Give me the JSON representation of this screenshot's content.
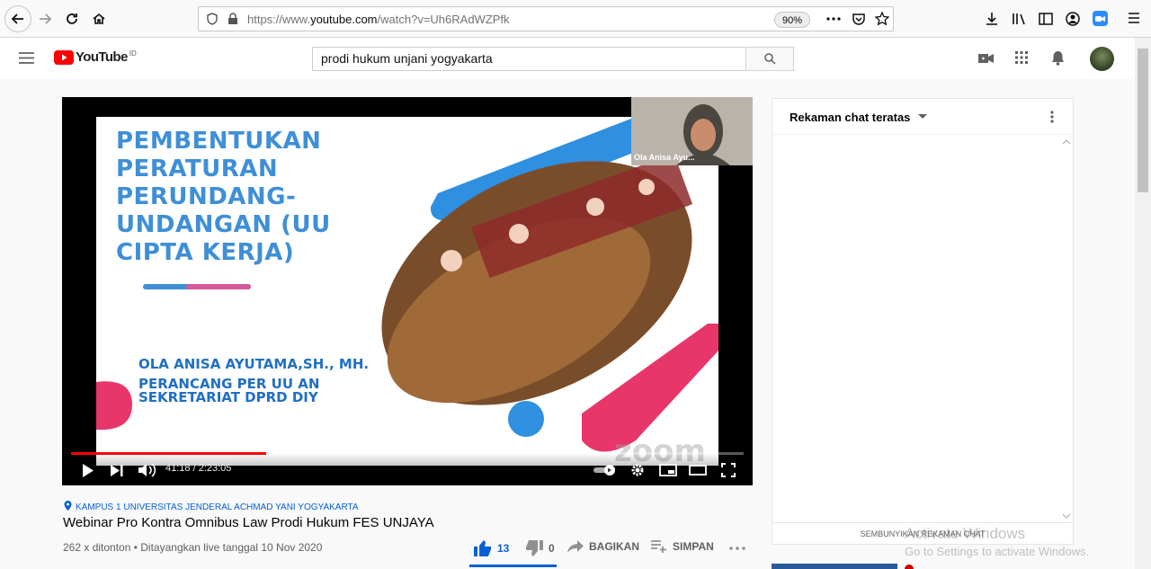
{
  "browser": {
    "url_prefix": "https://www.",
    "url_domain": "youtube.com",
    "url_path": "/watch?v=Uh6RAdWZPfk",
    "zoom": "90%"
  },
  "header": {
    "logo_text": "YouTube",
    "logo_region": "ID",
    "search_value": "prodi hukum unjani yogyakarta"
  },
  "player": {
    "slide_title": "PEMBENTUKAN PERATURAN PERUNDANG-UNDANGAN (UU CIPTA KERJA)",
    "speaker_name": "OLA ANISA AYUTAMA,SH., MH.",
    "speaker_role": "PERANCANG PER UU AN SEKRETARIAT DPRD DIY",
    "pip_name": "Ola Anisa Ayu...",
    "zoom_watermark": "zoom",
    "time": "41:18 / 2:23:05",
    "progress": 0.29
  },
  "video": {
    "location": "KAMPUS 1 UNIVERSITAS JENDERAL ACHMAD YANI YOGYAKARTA",
    "title": "Webinar Pro Kontra Omnibus Law Prodi Hukum FES UNJAYA",
    "info": "262 x ditonton • Ditayangkan live tanggal 10 Nov 2020",
    "likes": "13",
    "dislikes": "0",
    "share_label": "BAGIKAN",
    "save_label": "SIMPAN"
  },
  "chat": {
    "title": "Rekaman chat teratas",
    "hide_label": "SEMBUNYIKAN REKAMAN CHAT"
  },
  "watermark": {
    "line1": "Activate Windows",
    "line2": "Go to Settings to activate Windows."
  },
  "colors": {
    "accent_red": "#ff0000",
    "link_blue": "#065fd4",
    "slide_blue": "#3f8fd6",
    "slide_pink": "#e8366b"
  }
}
